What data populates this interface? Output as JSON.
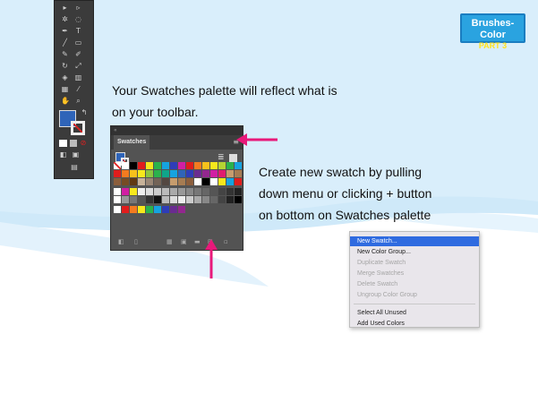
{
  "badge": {
    "line1": "Brushes-Color",
    "line2": "PART 3"
  },
  "captions": {
    "palette_line1": "Your Swatches palette will reflect what is",
    "palette_line2": "on your toolbar.",
    "new_line1": "Create new swatch by pulling",
    "new_line2": "down menu or clicking + button",
    "new_line3": "on bottom on Swatches palette"
  },
  "swatches_panel": {
    "tab_label": "Swatches"
  },
  "menu": {
    "items": [
      {
        "label": "New Swatch...",
        "state": "highlighted"
      },
      {
        "label": "New Color Group...",
        "state": "enabled"
      },
      {
        "label": "Duplicate Swatch",
        "state": "disabled"
      },
      {
        "label": "Merge Swatches",
        "state": "disabled"
      },
      {
        "label": "Delete Swatch",
        "state": "disabled"
      },
      {
        "label": "Ungroup Color Group",
        "state": "disabled"
      },
      {
        "label": "Select All Unused",
        "state": "enabled"
      },
      {
        "label": "Add Used Colors",
        "state": "enabled"
      }
    ]
  },
  "colors": {
    "arrow": "#e8197a",
    "badge_bg": "#2aa3e0",
    "badge_subtitle": "#ffe21a",
    "fill_color": "#2f64b8",
    "menu_highlight": "#2f6be0",
    "wave": "#cfe9f9"
  },
  "icons": {
    "toolbar_tools": [
      "selection",
      "direct-selection",
      "magic-wand",
      "lasso",
      "pen",
      "type",
      "line",
      "rectangle",
      "paintbrush",
      "pencil",
      "eraser",
      "rotate",
      "scale",
      "width",
      "shape-builder",
      "perspective",
      "mesh",
      "gradient",
      "eyedropper",
      "blend",
      "symbol-sprayer",
      "column-graph",
      "artboard",
      "slice",
      "hand",
      "zoom"
    ],
    "swatch_bottom": [
      "swatch-libraries",
      "show-kind",
      "swatch-options",
      "color-group",
      "folder",
      "new-swatch",
      "delete"
    ]
  }
}
